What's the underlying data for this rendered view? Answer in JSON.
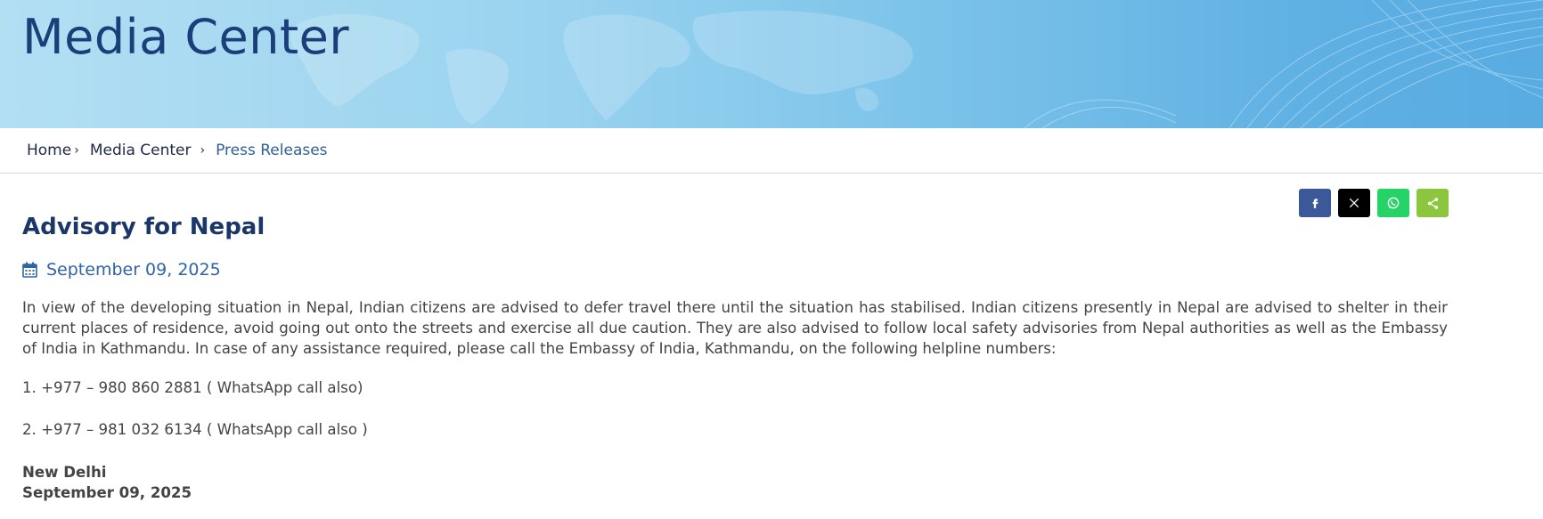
{
  "banner": {
    "title": "Media Center"
  },
  "breadcrumb": {
    "items": [
      {
        "label": "Home"
      },
      {
        "label": "Media Center"
      },
      {
        "label": "Press Releases"
      }
    ],
    "separator": "›"
  },
  "share": {
    "buttons": [
      {
        "name": "facebook",
        "icon": "facebook-icon",
        "color": "#3b5998"
      },
      {
        "name": "x",
        "icon": "x-icon",
        "color": "#000000"
      },
      {
        "name": "whatsapp",
        "icon": "whatsapp-icon",
        "color": "#25d366"
      },
      {
        "name": "share",
        "icon": "share-icon",
        "color": "#8cc63f"
      }
    ]
  },
  "article": {
    "title": "Advisory for Nepal",
    "date": "September 09, 2025",
    "body": "In view of the developing situation in Nepal, Indian citizens are advised to defer travel there until the situation has stabilised. Indian citizens presently in Nepal are advised to shelter in their current places of residence, avoid going out onto the streets and exercise all due caution. They are also advised to follow local safety advisories from Nepal authorities as well as the Embassy of India in Kathmandu. In case of any assistance required, please call the Embassy of India, Kathmandu, on the following helpline numbers:",
    "helplines": [
      "1. +977 – 980 860 2881 ( WhatsApp call also)",
      "2. +977 – 981 032 6134 ( WhatsApp call also )"
    ],
    "sign_place": "New Delhi",
    "sign_date": "September 09, 2025"
  },
  "colors": {
    "title": "#1b3768",
    "date": "#2f64a6",
    "banner_title": "#1b3f7a"
  }
}
